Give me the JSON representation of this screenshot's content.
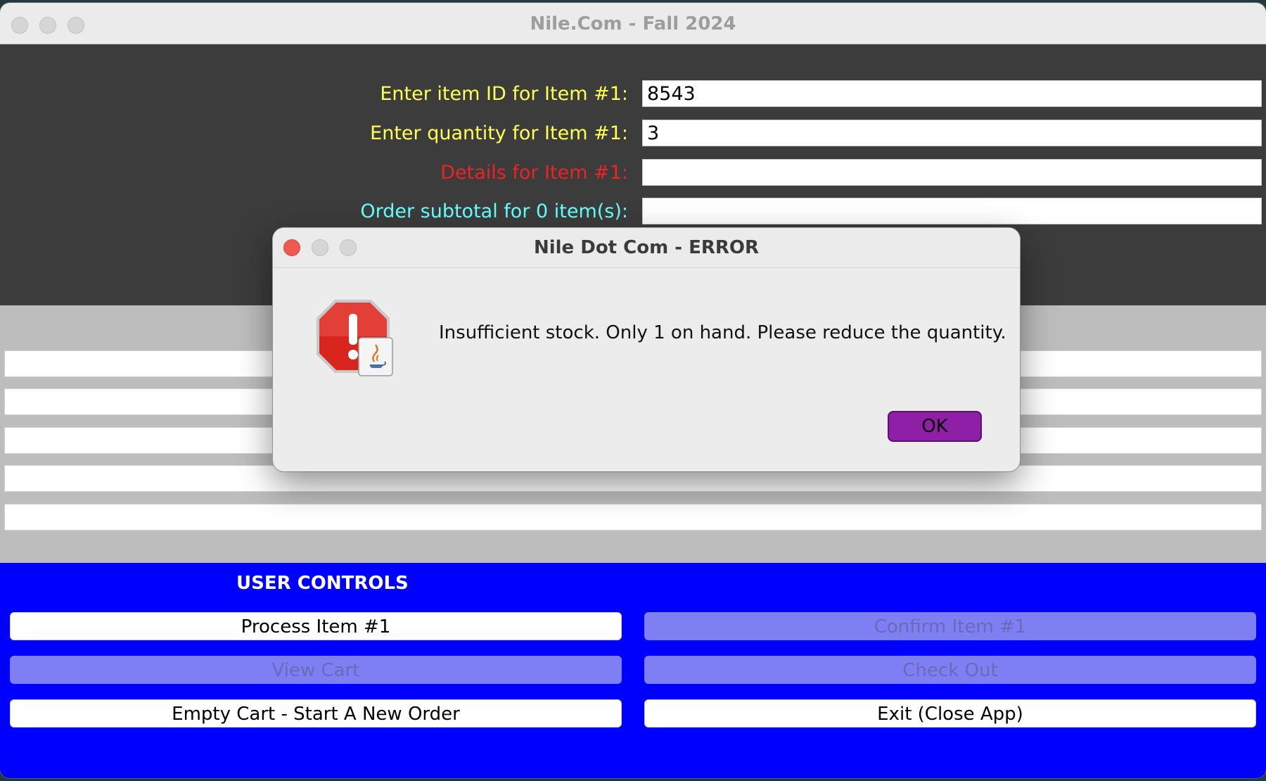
{
  "window": {
    "title": "Nile.Com - Fall 2024"
  },
  "form": {
    "item_id": {
      "label": "Enter item ID for Item #1:",
      "value": "8543",
      "color": "#ffff55"
    },
    "quantity": {
      "label": "Enter quantity for Item #1:",
      "value": "3",
      "color": "#ffff55"
    },
    "details": {
      "label": "Details for Item #1:",
      "value": "",
      "color": "#ee2222"
    },
    "subtotal": {
      "label": "Order subtotal for 0 item(s):",
      "value": "",
      "color": "#66ffff"
    }
  },
  "cart_rows": [
    "",
    "",
    "",
    "",
    ""
  ],
  "controls": {
    "title": "USER CONTROLS",
    "process_item": "Process Item #1",
    "confirm_item": "Confirm Item #1",
    "view_cart": "View Cart",
    "check_out": "Check Out",
    "empty_cart": "Empty Cart - Start A New Order",
    "exit": "Exit (Close App)"
  },
  "dialog": {
    "title": "Nile Dot Com - ERROR",
    "message": "Insufficient stock. Only 1 on hand. Please reduce the quantity.",
    "ok_label": "OK",
    "icon": "error-stop-icon"
  },
  "colors": {
    "controls_background": "#0000ff",
    "disabled_button": "#7f7ff4",
    "ok_button": "#8e1fa6",
    "close_light": "#ee5a52"
  }
}
